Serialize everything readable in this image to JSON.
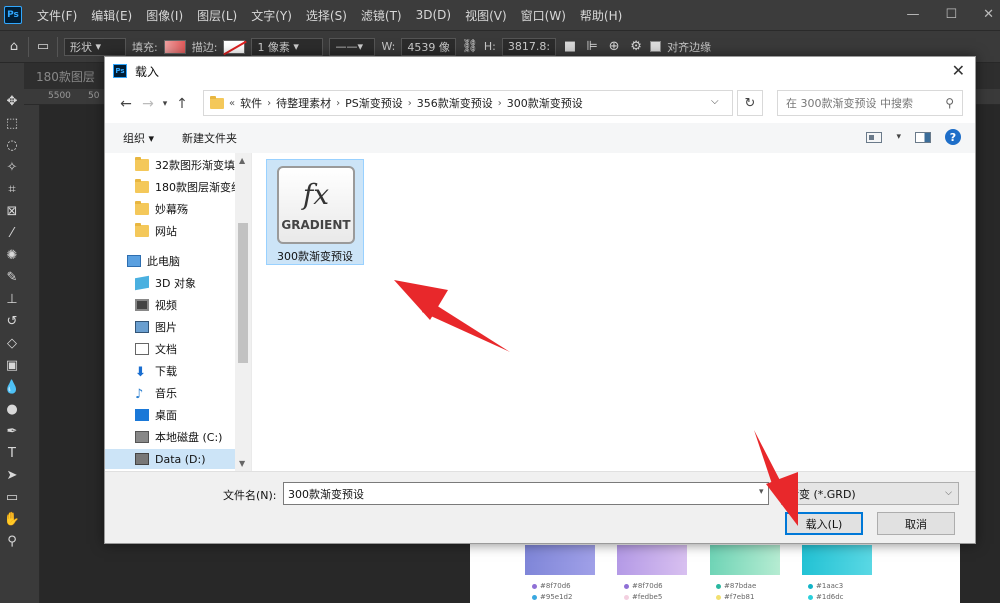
{
  "menubar": {
    "logo": "Ps",
    "items": [
      "文件(F)",
      "编辑(E)",
      "图像(I)",
      "图层(L)",
      "文字(Y)",
      "选择(S)",
      "滤镜(T)",
      "3D(D)",
      "视图(V)",
      "窗口(W)",
      "帮助(H)"
    ],
    "window_controls": [
      "—",
      "☐",
      "✕"
    ]
  },
  "options_bar": {
    "shape_mode": "形状",
    "fill_label": "填充:",
    "stroke_label": "描边:",
    "stroke_width": "1 像素",
    "width_label": "W:",
    "width_value": "4539 像",
    "height_label": "H:",
    "height_value": "3817.8:",
    "align_edges": "对齐边缘"
  },
  "document": {
    "tab_title": "180款图层",
    "ruler_marks": [
      "5500",
      "50"
    ],
    "swatch_labels": [
      [
        "#8f70d6",
        "#95e1d2"
      ],
      [
        "#8f70d6",
        "#fedbe5"
      ],
      [
        "#87bdae",
        "#f7eb81"
      ],
      [
        "#1aac3",
        "#1d6dc"
      ]
    ],
    "swatch_colors": [
      "#8b8fdc",
      "#c6a8e6",
      "#7dd8c0",
      "#3ac8d8"
    ]
  },
  "dialog": {
    "title": "载入",
    "title_icon": "Ps",
    "address": {
      "prefix": "«",
      "crumbs": [
        "软件",
        "待整理素材",
        "PS渐变预设",
        "356款渐变预设",
        "300款渐变预设"
      ]
    },
    "search_placeholder": "在 300款渐变预设 中搜索",
    "toolbar": {
      "organize": "组织 ▾",
      "new_folder": "新建文件夹"
    },
    "nav_items": [
      "32款图形渐变填",
      "180款图层渐变组",
      "妙幕殇",
      "网站",
      "此电脑",
      "3D 对象",
      "视频",
      "图片",
      "文档",
      "下载",
      "音乐",
      "桌面",
      "本地磁盘 (C:)",
      "Data (D:)"
    ],
    "file": {
      "icon_fx": "fx",
      "icon_label": "GRADIENT",
      "name": "300款渐变预设"
    },
    "filename_label": "文件名(N):",
    "filename_value": "300款渐变预设",
    "filetype_value": "渐变 (*.GRD)",
    "load_button": "载入(L)",
    "cancel_button": "取消"
  },
  "colors": {
    "arrow": "#e8282b",
    "selection": "#cce4f7",
    "accent": "#0078d7"
  }
}
